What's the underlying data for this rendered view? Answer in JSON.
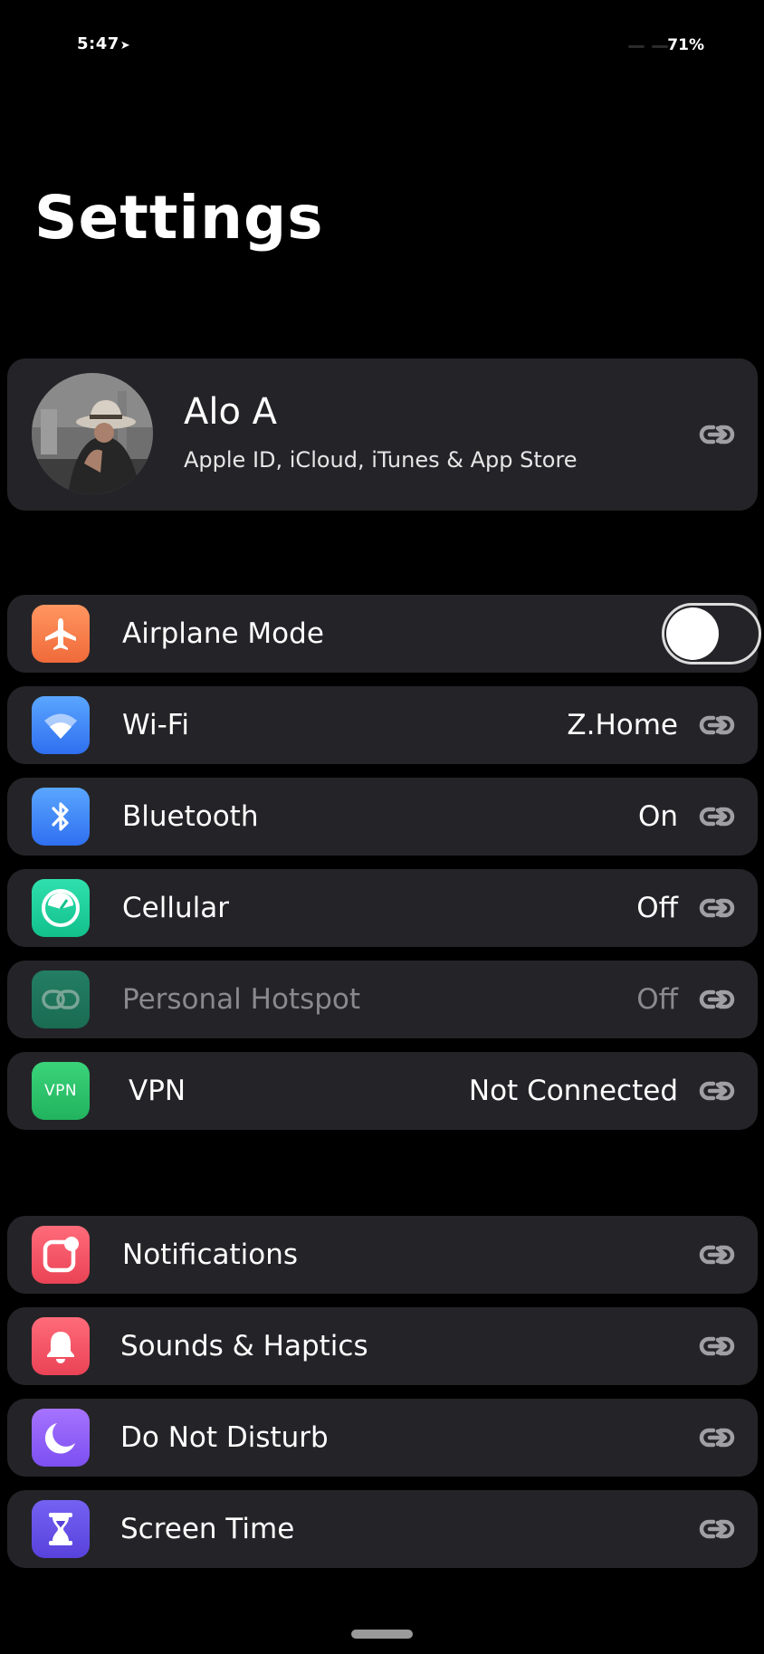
{
  "status_bar": {
    "time": "5:47",
    "location_glyph": "➤",
    "battery": "71%"
  },
  "title": "Settings",
  "profile": {
    "name": "Alo A",
    "subtitle": "Apple ID, iCloud, iTunes & App Store"
  },
  "connectivity": [
    {
      "id": "airplane",
      "label": "Airplane Mode",
      "icon": "airplane-icon",
      "color": "#f57f4b",
      "toggle": false
    },
    {
      "id": "wifi",
      "label": "Wi-Fi",
      "value": "Z.Home",
      "icon": "wifi-icon",
      "color": "#3e8bf6"
    },
    {
      "id": "bluetooth",
      "label": "Bluetooth",
      "value": "On",
      "icon": "bluetooth-icon",
      "color": "#3e8bf6"
    },
    {
      "id": "cellular",
      "label": "Cellular",
      "value": "Off",
      "icon": "cellular-icon",
      "color": "#1fd19b"
    },
    {
      "id": "hotspot",
      "label": "Personal Hotspot",
      "value": "Off",
      "icon": "hotspot-icon",
      "color": "#1c7a5e",
      "disabled": true
    },
    {
      "id": "vpn",
      "label": "VPN",
      "value": "Not Connected",
      "icon": "vpn-icon",
      "icon_text": "VPN",
      "color": "#2fc46a"
    }
  ],
  "general": [
    {
      "id": "notifications",
      "label": "Notifications",
      "icon": "notifications-icon",
      "color": "#f05463"
    },
    {
      "id": "sounds",
      "label": "Sounds & Haptics",
      "icon": "bell-icon",
      "color": "#f05463"
    },
    {
      "id": "dnd",
      "label": "Do Not Disturb",
      "icon": "moon-icon",
      "color": "#8b5cf6"
    },
    {
      "id": "screentime",
      "label": "Screen Time",
      "icon": "hourglass-icon",
      "color": "#6a4fe6"
    }
  ]
}
